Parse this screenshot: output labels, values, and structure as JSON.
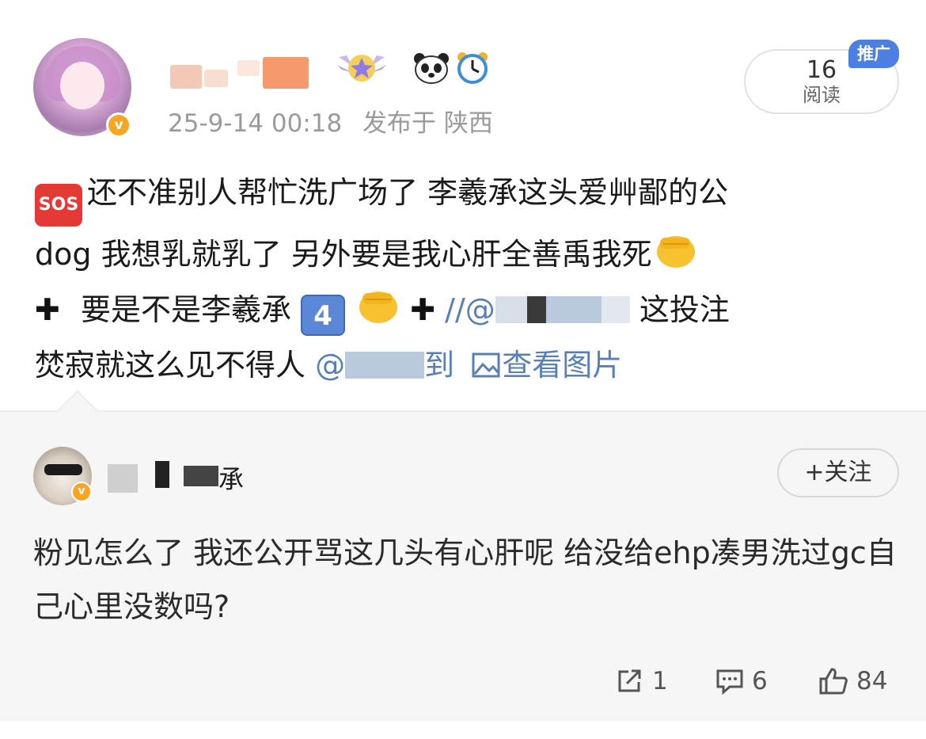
{
  "post": {
    "timestamp": "25-9-14 00:18",
    "location_label": "发布于 陕西",
    "views_count": "16",
    "views_label": "阅读",
    "promo_badge": "推广",
    "sos_label": "SOS",
    "text_line1": "还不准别人帮忙洗广场了 李羲承这头爱艸鄙的公",
    "text_line2": "dog 我想乳就乳了 另外要是我心肝全善禹我死",
    "text_line3_a": "要是不是李羲承",
    "key_four": "4",
    "text_line3_b": "//@",
    "text_line3_c": "这投注",
    "text_line4_a": "焚寂就这么见不得人",
    "text_line4_b": "@",
    "text_line4_c": "到",
    "view_images": "查看图片",
    "icons": [
      "wing-badge-icon",
      "panda-icon",
      "alarm-clock-icon",
      "sos-icon",
      "fist-icon",
      "plus-icon",
      "keycap-4-icon",
      "image-icon",
      "verified-icon"
    ]
  },
  "comment": {
    "name_suffix": "承",
    "follow_label": "+关注",
    "text": "粉见怎么了 我还公开骂这几头有心肝呢 给没给ehp凑男洗过gc自己心里没数吗?",
    "share_count": "1",
    "comment_count": "6",
    "like_count": "84"
  },
  "colors": {
    "link": "#5a7fb6",
    "verified": "#f6a623",
    "promo": "#4c7fe3",
    "sos": "#e53935"
  }
}
